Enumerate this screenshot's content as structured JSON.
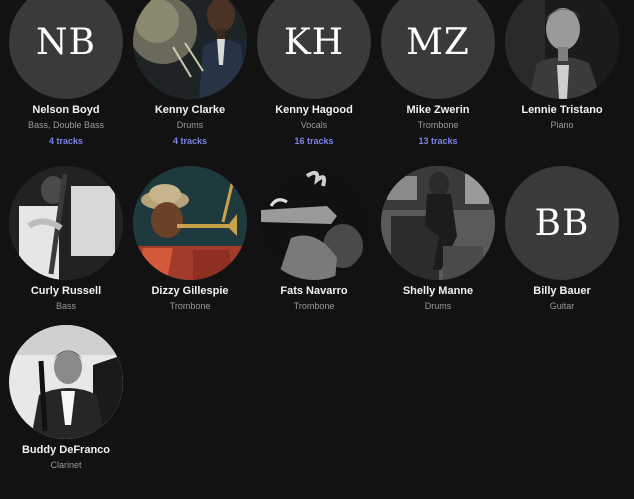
{
  "artists": [
    {
      "initials": "NB",
      "name": "Nelson Boyd",
      "role": "Bass, Double Bass",
      "tracks": "4 tracks",
      "icon": "initials-avatar"
    },
    {
      "initials": "",
      "name": "Kenny Clarke",
      "role": "Drums",
      "tracks": "4 tracks",
      "icon": "photo-drummer"
    },
    {
      "initials": "KH",
      "name": "Kenny Hagood",
      "role": "Vocals",
      "tracks": "16 tracks",
      "icon": "initials-avatar"
    },
    {
      "initials": "MZ",
      "name": "Mike Zwerin",
      "role": "Trombone",
      "tracks": "13 tracks",
      "icon": "initials-avatar"
    },
    {
      "initials": "",
      "name": "Lennie Tristano",
      "role": "Piano",
      "tracks": "",
      "icon": "photo-pianist"
    },
    {
      "initials": "",
      "name": "Curly Russell",
      "role": "Bass",
      "tracks": "",
      "icon": "photo-bassist"
    },
    {
      "initials": "",
      "name": "Dizzy Gillespie",
      "role": "Trombone",
      "tracks": "",
      "icon": "photo-trumpeter"
    },
    {
      "initials": "",
      "name": "Fats Navarro",
      "role": "Trombone",
      "tracks": "",
      "icon": "photo-trumpeter-bw"
    },
    {
      "initials": "",
      "name": "Shelly Manne",
      "role": "Drums",
      "tracks": "",
      "icon": "photo-drummer-bw"
    },
    {
      "initials": "BB",
      "name": "Billy Bauer",
      "role": "Guitar",
      "tracks": "",
      "icon": "initials-avatar"
    },
    {
      "initials": "",
      "name": "Buddy DeFranco",
      "role": "Clarinet",
      "tracks": "",
      "icon": "photo-clarinetist"
    }
  ],
  "colors": {
    "background": "#121212",
    "avatar_placeholder": "#3a3a3a",
    "tracks_link": "#7b84e6",
    "name": "#f2f2f2",
    "role": "#9a9a9a"
  }
}
